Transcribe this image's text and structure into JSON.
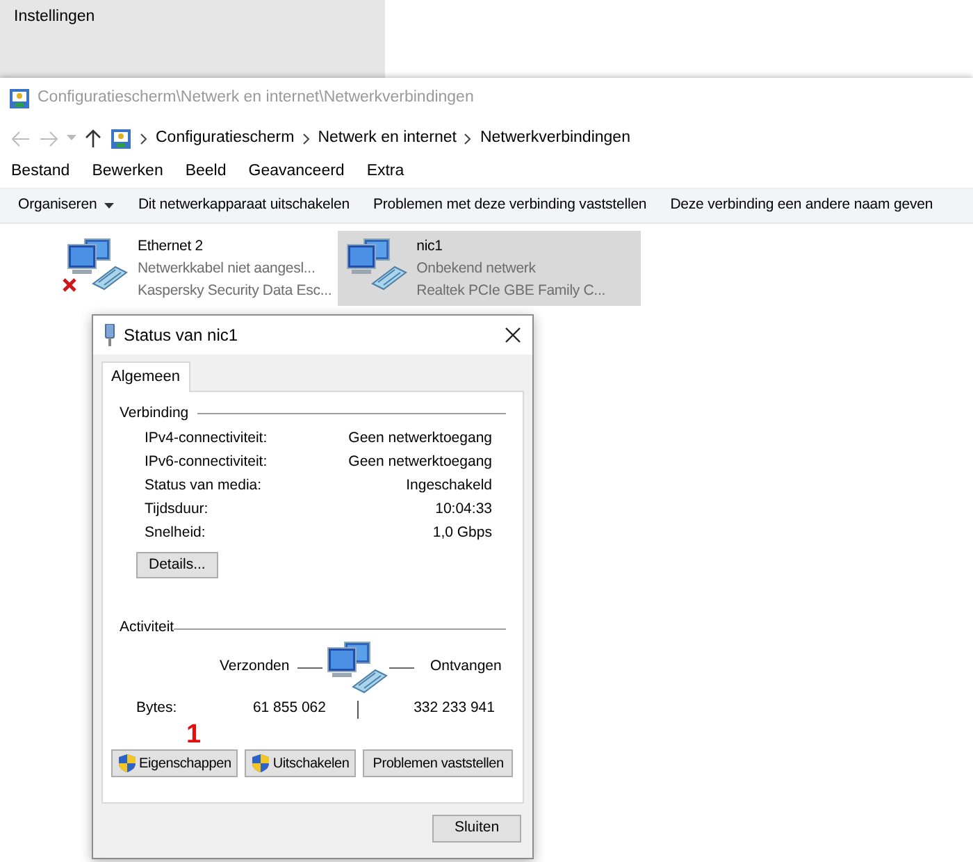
{
  "background_window": {
    "title": "Instellingen"
  },
  "explorer": {
    "title": "Configuratiescherm\\Netwerk en internet\\Netwerkverbindingen",
    "breadcrumb": [
      "Configuratiescherm",
      "Netwerk en internet",
      "Netwerkverbindingen"
    ],
    "menu": [
      "Bestand",
      "Bewerken",
      "Beeld",
      "Geavanceerd",
      "Extra"
    ],
    "commands": [
      {
        "label": "Organiseren",
        "dropdown": true
      },
      {
        "label": "Dit netwerkapparaat uitschakelen",
        "dropdown": false
      },
      {
        "label": "Problemen met deze verbinding vaststellen",
        "dropdown": false
      },
      {
        "label": "Deze verbinding een andere naam geven",
        "dropdown": false
      }
    ],
    "connections": [
      {
        "name": "Ethernet 2",
        "status": "Netwerkkabel niet aangesl...",
        "adapter": "Kaspersky Security Data Esc...",
        "disconnected": true,
        "selected": false
      },
      {
        "name": "nic1",
        "status": "Onbekend netwerk",
        "adapter": "Realtek PCIe GBE Family C...",
        "disconnected": false,
        "selected": true
      }
    ]
  },
  "dialog": {
    "title": "Status van nic1",
    "tabs": [
      {
        "label": "Algemeen",
        "selected": true
      }
    ],
    "connection": {
      "heading": "Verbinding",
      "rows": [
        {
          "label": "IPv4-connectiviteit:",
          "value": "Geen netwerktoegang"
        },
        {
          "label": "IPv6-connectiviteit:",
          "value": "Geen netwerktoegang"
        },
        {
          "label": "Status van media:",
          "value": "Ingeschakeld"
        },
        {
          "label": "Tijdsduur:",
          "value": "10:04:33"
        },
        {
          "label": "Snelheid:",
          "value": "1,0 Gbps"
        }
      ],
      "details_button": "Details..."
    },
    "activity": {
      "heading": "Activiteit",
      "sent_label": "Verzonden",
      "received_label": "Ontvangen",
      "bytes_label": "Bytes:",
      "sent": "61 855 062",
      "received": "332 233 941"
    },
    "annotation": "1",
    "buttons": [
      {
        "label": "Eigenschappen",
        "shield": true
      },
      {
        "label": "Uitschakelen",
        "shield": true
      },
      {
        "label": "Problemen vaststellen",
        "shield": false
      }
    ],
    "close_button": "Sluiten"
  }
}
